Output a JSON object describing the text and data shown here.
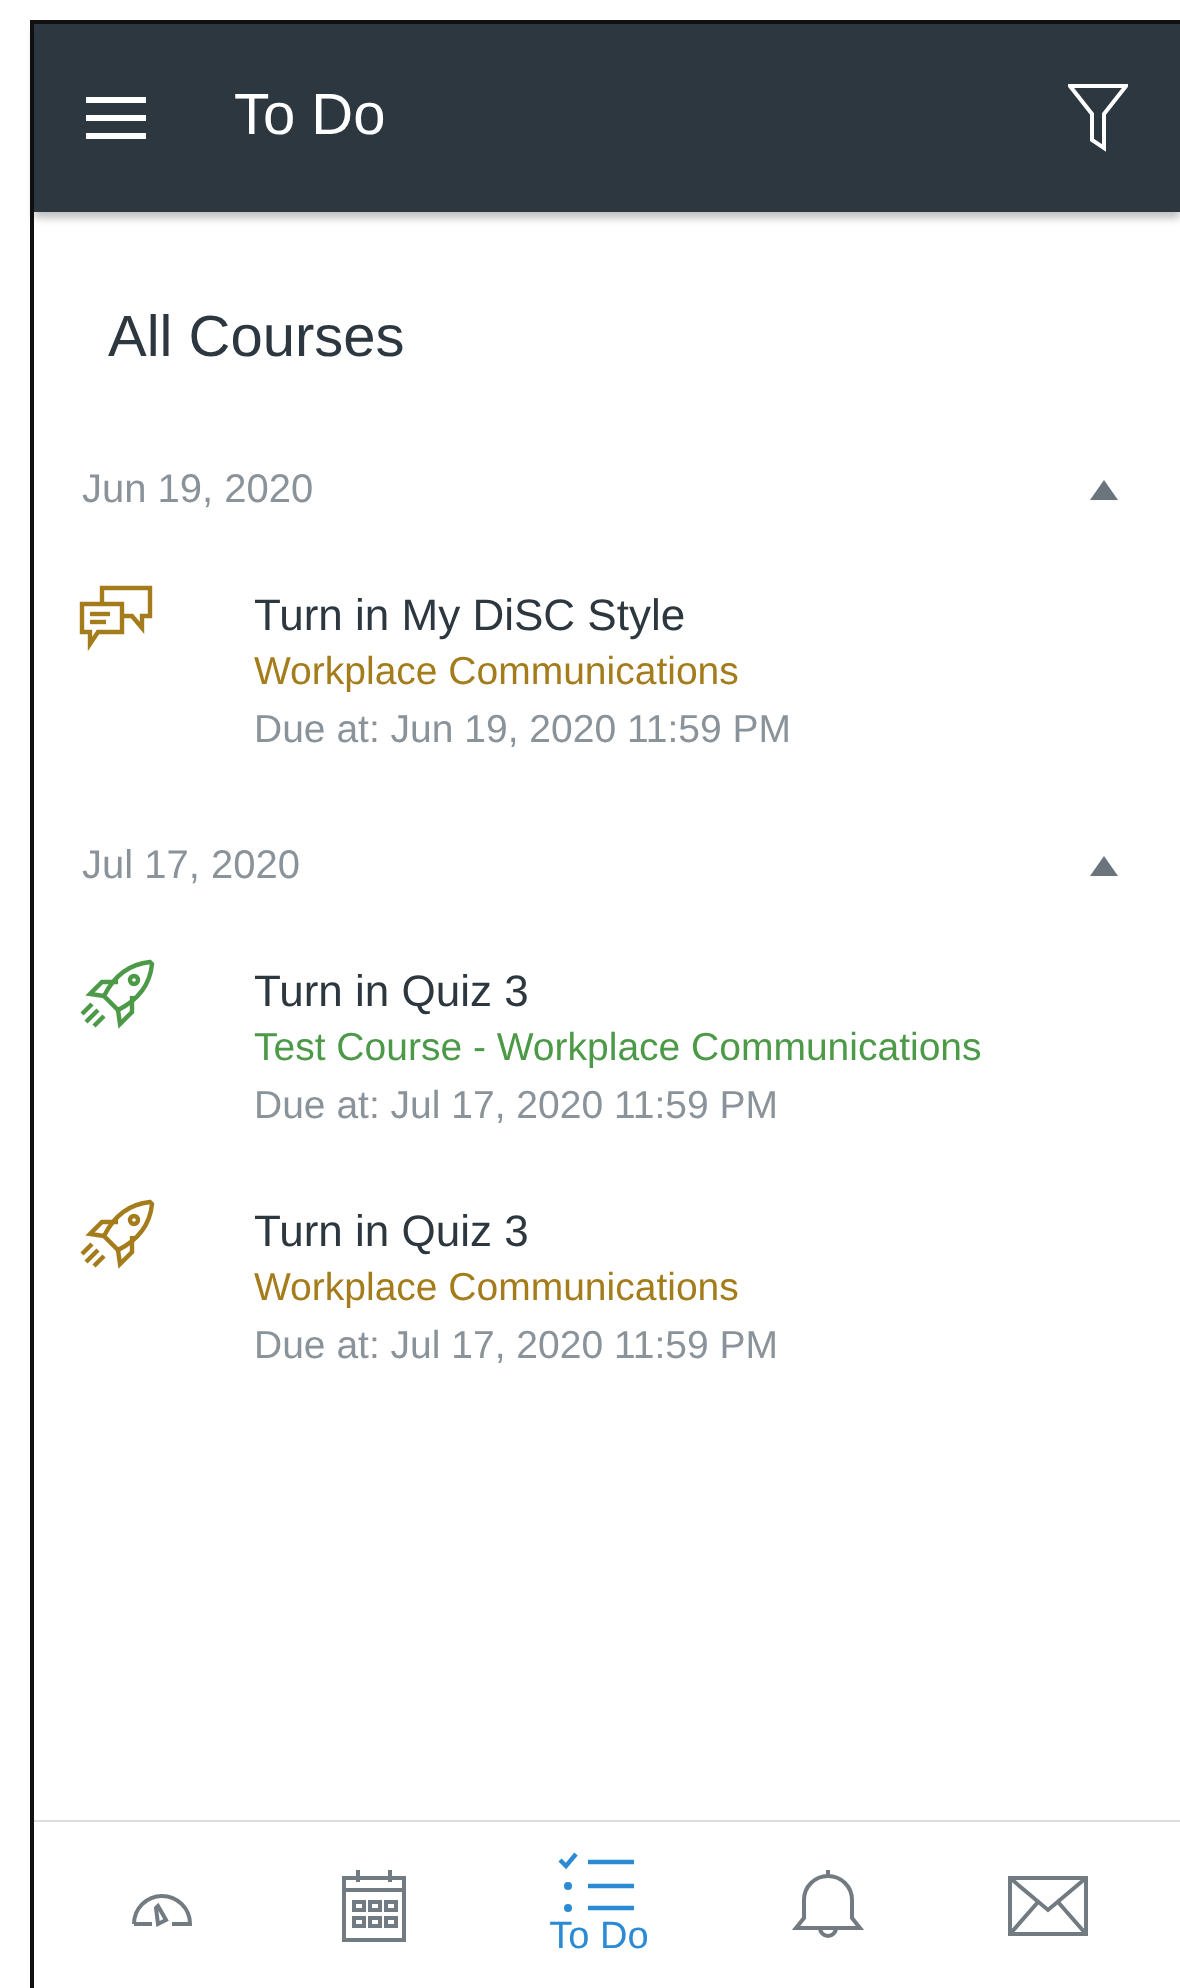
{
  "header": {
    "title": "To Do"
  },
  "filter": "All Courses",
  "groups": [
    {
      "date": "Jun 19, 2020",
      "expanded": true,
      "items": [
        {
          "kind": "discussion",
          "title": "Turn in My DiSC Style",
          "course": "Workplace Communications",
          "color": "#a57c1b",
          "due": "Due at: Jun 19, 2020 11:59 PM"
        }
      ]
    },
    {
      "date": "Jul 17, 2020",
      "expanded": true,
      "items": [
        {
          "kind": "quiz",
          "title": "Turn in Quiz 3",
          "course": "Test Course - Workplace Communications",
          "color": "#4c9a48",
          "due": "Due at: Jul 17, 2020 11:59 PM"
        },
        {
          "kind": "quiz",
          "title": "Turn in Quiz 3",
          "course": "Workplace Communications",
          "color": "#a57c1b",
          "due": "Due at: Jul 17, 2020 11:59 PM"
        }
      ]
    }
  ],
  "tabs": [
    {
      "kind": "dashboard",
      "selected": false
    },
    {
      "kind": "calendar",
      "selected": false
    },
    {
      "kind": "todo",
      "label": "To Do",
      "selected": true
    },
    {
      "kind": "notifications",
      "selected": false
    },
    {
      "kind": "inbox",
      "selected": false
    }
  ]
}
